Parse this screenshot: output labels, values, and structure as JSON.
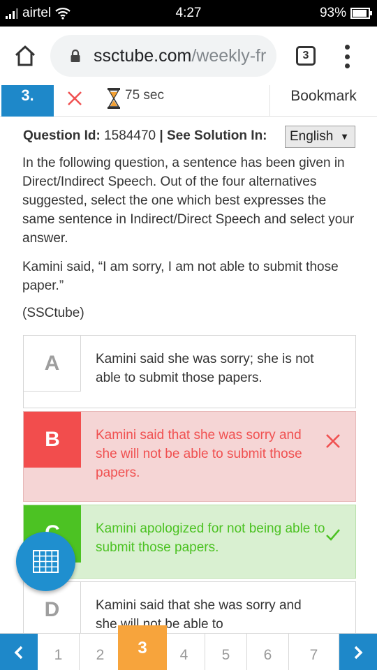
{
  "status_bar": {
    "carrier": "airtel",
    "time": "4:27",
    "battery": "93%",
    "battery_level": 0.93
  },
  "browser": {
    "url_domain": "ssctube.com",
    "url_path": "/weekly-fr",
    "tab_count": "3"
  },
  "question": {
    "number": "3.",
    "timer": "75 sec",
    "bookmark_label": "Bookmark",
    "id_label": "Question Id:",
    "id_value": "1584470",
    "solution_label": "| See Solution In:",
    "language": "English",
    "text": "In the following question, a sentence has been given in Direct/Indirect Speech. Out of the four alternatives suggested, select the one which best expresses the same sentence in Indirect/Direct Speech and select your answer.",
    "sentence": "Kamini said, “I am sorry, I am not able to submit those paper.”",
    "source": "(SSCtube)"
  },
  "options": [
    {
      "letter": "A",
      "text": "Kamini said she was sorry; she is not able to submit those papers.",
      "state": "normal"
    },
    {
      "letter": "B",
      "text": "Kamini said that she was sorry and she will not be able to submit those papers.",
      "state": "wrong"
    },
    {
      "letter": "C",
      "text": "Kamini apologized for not being able to submit those papers.",
      "state": "correct"
    },
    {
      "letter": "D",
      "text": "Kamini said that she was sorry and she will not be able to",
      "state": "normal"
    }
  ],
  "pager": {
    "pages": [
      "1",
      "2",
      "3",
      "4",
      "5",
      "6",
      "7"
    ],
    "current": "3"
  },
  "colors": {
    "primary": "#1e88c9",
    "wrong": "#f24d4d",
    "correct": "#4cc223",
    "active_page": "#f7a43c"
  }
}
